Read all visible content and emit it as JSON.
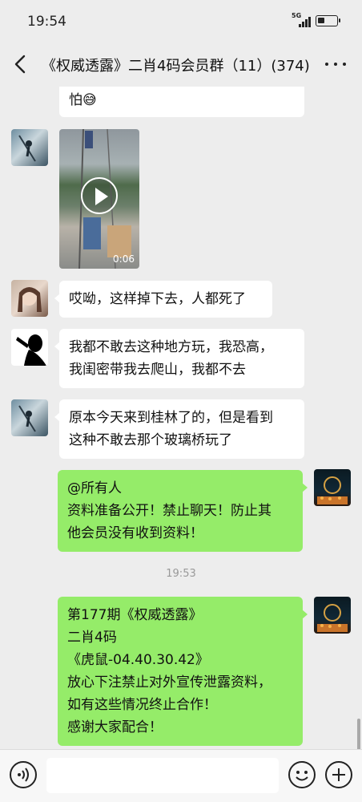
{
  "status_bar": {
    "time": "19:54",
    "network": "5G",
    "battery_level": 0.35
  },
  "nav": {
    "title": "《权威透露》二肖4码会员群（11）(374)"
  },
  "messages": [
    {
      "sender": "other",
      "type": "text",
      "lines": [
        "怕😅"
      ]
    },
    {
      "sender": "other",
      "type": "video",
      "duration": "0:06"
    },
    {
      "sender": "other",
      "type": "text",
      "lines": [
        "哎呦，这样掉下去，人都死了"
      ]
    },
    {
      "sender": "other",
      "type": "text",
      "lines": [
        "我都不敢去这种地方玩，我恐高，",
        "我闺密带我去爬山，我都不去"
      ]
    },
    {
      "sender": "other",
      "type": "text",
      "lines": [
        "原本今天来到桂林了的，但是看到",
        "这种不敢去那个玻璃桥玩了"
      ]
    },
    {
      "sender": "self",
      "type": "text",
      "lines": [
        "@所有人",
        "资料准备公开！禁止聊天！防止其",
        "他会员没有收到资料！"
      ]
    },
    {
      "type": "timestamp",
      "text": "19:53"
    },
    {
      "sender": "self",
      "type": "text",
      "lines": [
        "第177期《权威透露》",
        "二肖4码",
        "《虎鼠-04.40.30.42》",
        "放心下注禁止对外宣传泄露资料，",
        "如有这些情况终止合作！",
        "感谢大家配合！"
      ]
    }
  ],
  "colors": {
    "background": "#ededed",
    "self_bubble": "#95ec69",
    "other_bubble": "#ffffff"
  },
  "icons": {
    "back": "chevron-left-icon",
    "more": "more-dots-icon",
    "voice": "voice-icon",
    "emoji": "emoji-icon",
    "plus": "plus-icon"
  }
}
